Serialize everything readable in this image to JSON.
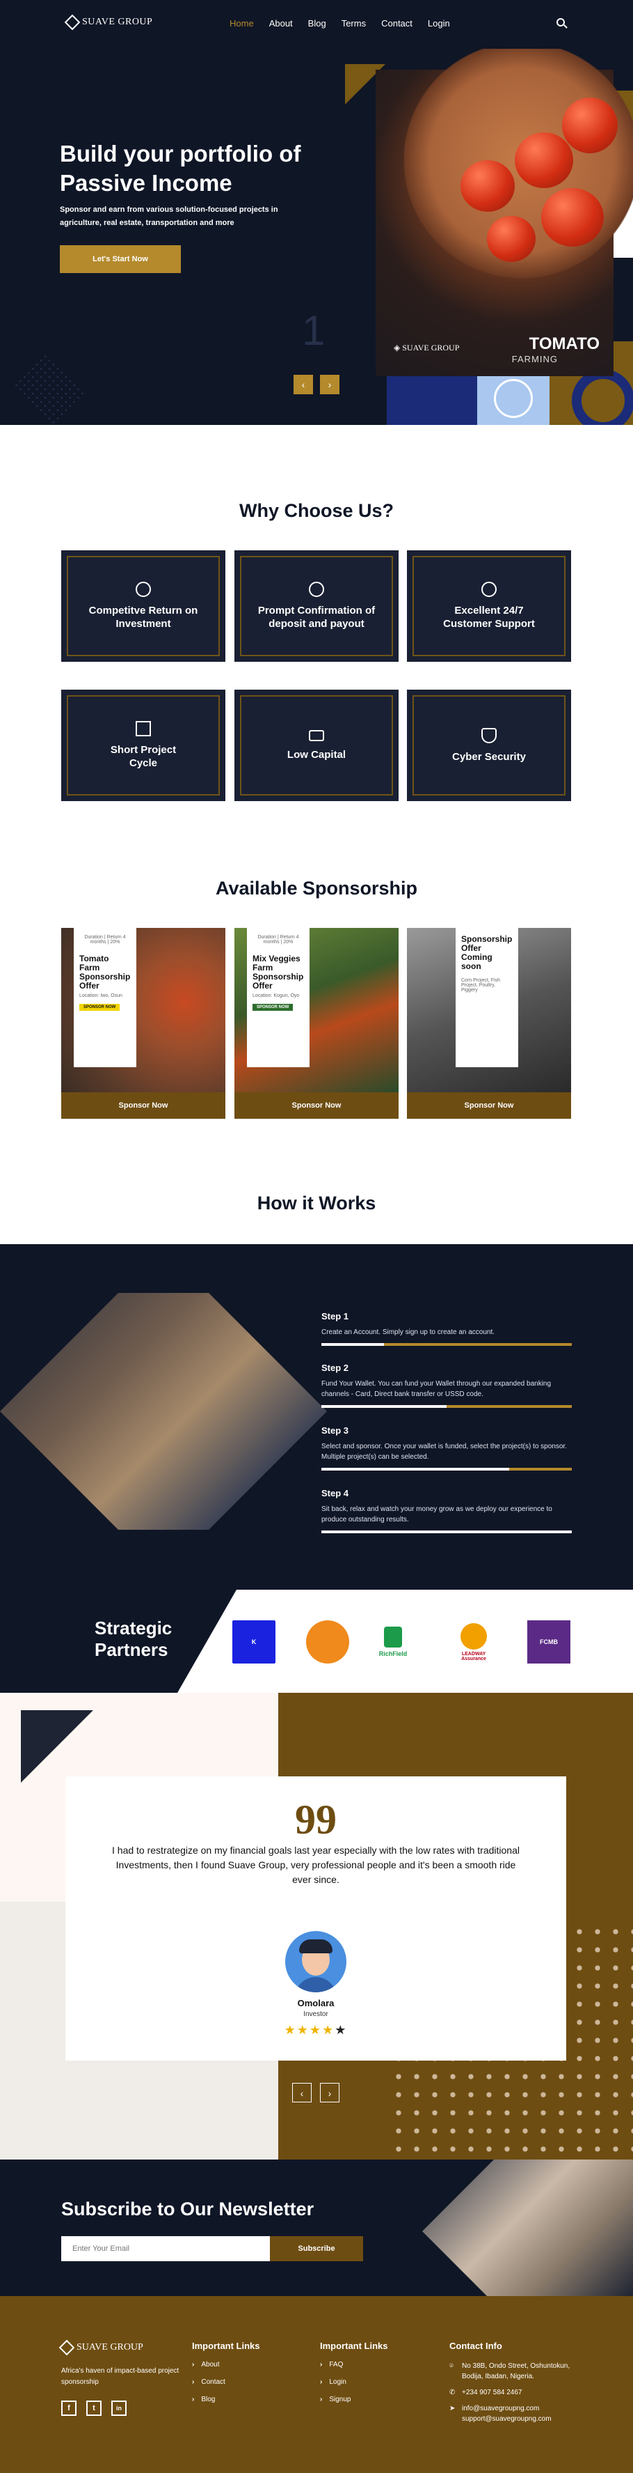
{
  "nav": {
    "brand": "SUAVE GROUP",
    "items": [
      "Home",
      "About",
      "Blog",
      "Terms",
      "Contact",
      "Login"
    ],
    "active": "Home"
  },
  "hero": {
    "title": "Build your portfolio of Passive Income",
    "subtitle": "Sponsor and earn from various solution-focused projects in agriculture, real estate, transportation and more",
    "cta": "Let's Start Now",
    "slide_number": "1",
    "prev": "‹",
    "next": "›",
    "image_brand": "SUAVE GROUP",
    "image_title": "TOMATO",
    "image_sub": "FARMING"
  },
  "why": {
    "title": "Why Choose Us?",
    "features": [
      {
        "label": "Competitve Return on Investment",
        "icon": "roi-icon"
      },
      {
        "label": "Prompt Confirmation of deposit and payout",
        "icon": "deposit-icon"
      },
      {
        "label": "Excellent 24/7 Customer Support",
        "icon": "support-icon"
      },
      {
        "label": "Short Project Cycle",
        "icon": "chart-icon"
      },
      {
        "label": "Low Capital",
        "icon": "cash-icon"
      },
      {
        "label": "Cyber Security",
        "icon": "shield-icon"
      }
    ]
  },
  "sponsorship": {
    "title": "Available Sponsorship",
    "cards": [
      {
        "flyer_title": "Tomato Farm Sponsorship Offer",
        "flyer_meta": "Duration | Return 4 months | 20%",
        "flyer_loc": "Location: Iwo, Osun",
        "flyer_tag": "SPONSOR NOW",
        "button": "Sponsor Now"
      },
      {
        "flyer_title": "Mix Veggies Farm Sponsorship Offer",
        "flyer_meta": "Duration | Return 4 months | 20%",
        "flyer_loc": "Location: Kogun, Oyo",
        "flyer_tag": "SPONSOR NOW",
        "button": "Sponsor Now"
      },
      {
        "flyer_title": "Sponsorship Offer Coming soon",
        "flyer_meta": "",
        "flyer_loc": "Corn Project, Fish Project, Poultry, Piggery",
        "flyer_tag": "",
        "button": "Sponsor Now"
      }
    ]
  },
  "how": {
    "title": "How it Works",
    "steps": [
      {
        "h": "Step 1",
        "d": "Create an Account. Simply sign up to create an account.",
        "progress": 0.25
      },
      {
        "h": "Step 2",
        "d": "Fund Your Wallet. You can fund your Wallet through our expanded banking channels - Card, Direct bank transfer or USSD code.",
        "progress": 0.5
      },
      {
        "h": "Step 3",
        "d": "Select and sponsor. Once your wallet is funded, select the project(s) to sponsor. Multiple project(s) can be selected.",
        "progress": 0.75
      },
      {
        "h": "Step 4",
        "d": "Sit back, relax and watch your money grow as we deploy our experience to produce outstanding results.",
        "progress": 1.0
      }
    ]
  },
  "partners": {
    "title": "Strategic Partners",
    "logos": [
      {
        "name": "K",
        "color": "#1a22e0"
      },
      {
        "name": "",
        "color": "#f08a1c"
      },
      {
        "name": "RichField",
        "color": "#1c9b4a"
      },
      {
        "name": "LEADWAY Assurance",
        "color": "#f2a000"
      },
      {
        "name": "FCMB",
        "color": "#5b2a86"
      }
    ]
  },
  "testimonial": {
    "quote_mark": "99",
    "text": "I had to restrategize on my financial goals last year especially  with the low rates with traditional Investments, then I found   Suave Group, very professional people and it's been a smooth ride  ever since.",
    "name": "Omolara",
    "role": "Investor",
    "rating": 4,
    "stars": "★★★★★",
    "prev": "‹",
    "next": "›"
  },
  "newsletter": {
    "title": "Subscribe to Our Newsletter",
    "placeholder": "Enter Your Email",
    "button": "Subscribe"
  },
  "footer": {
    "brand": "SUAVE GROUP",
    "tagline": "Africa's haven of impact-based project sponsorship",
    "social": [
      "f",
      "t",
      "in"
    ],
    "col1_title": "Important Links",
    "col1": [
      "About",
      "Contact",
      "Blog"
    ],
    "col2_title": "Important Links",
    "col2": [
      "FAQ",
      "Login",
      "Signup"
    ],
    "contact_title": "Contact Info",
    "address": "No 38B, Ondo Street, Oshuntokun, Bodija, Ibadan, Nigeria.",
    "phone": "+234 907 584 2467",
    "email1": "info@suavegroupng.com",
    "email2": "support@suavegroupng.com"
  },
  "colors": {
    "navy": "#0f1626",
    "gold": "#b48a2c",
    "brown": "#6e4d12"
  }
}
